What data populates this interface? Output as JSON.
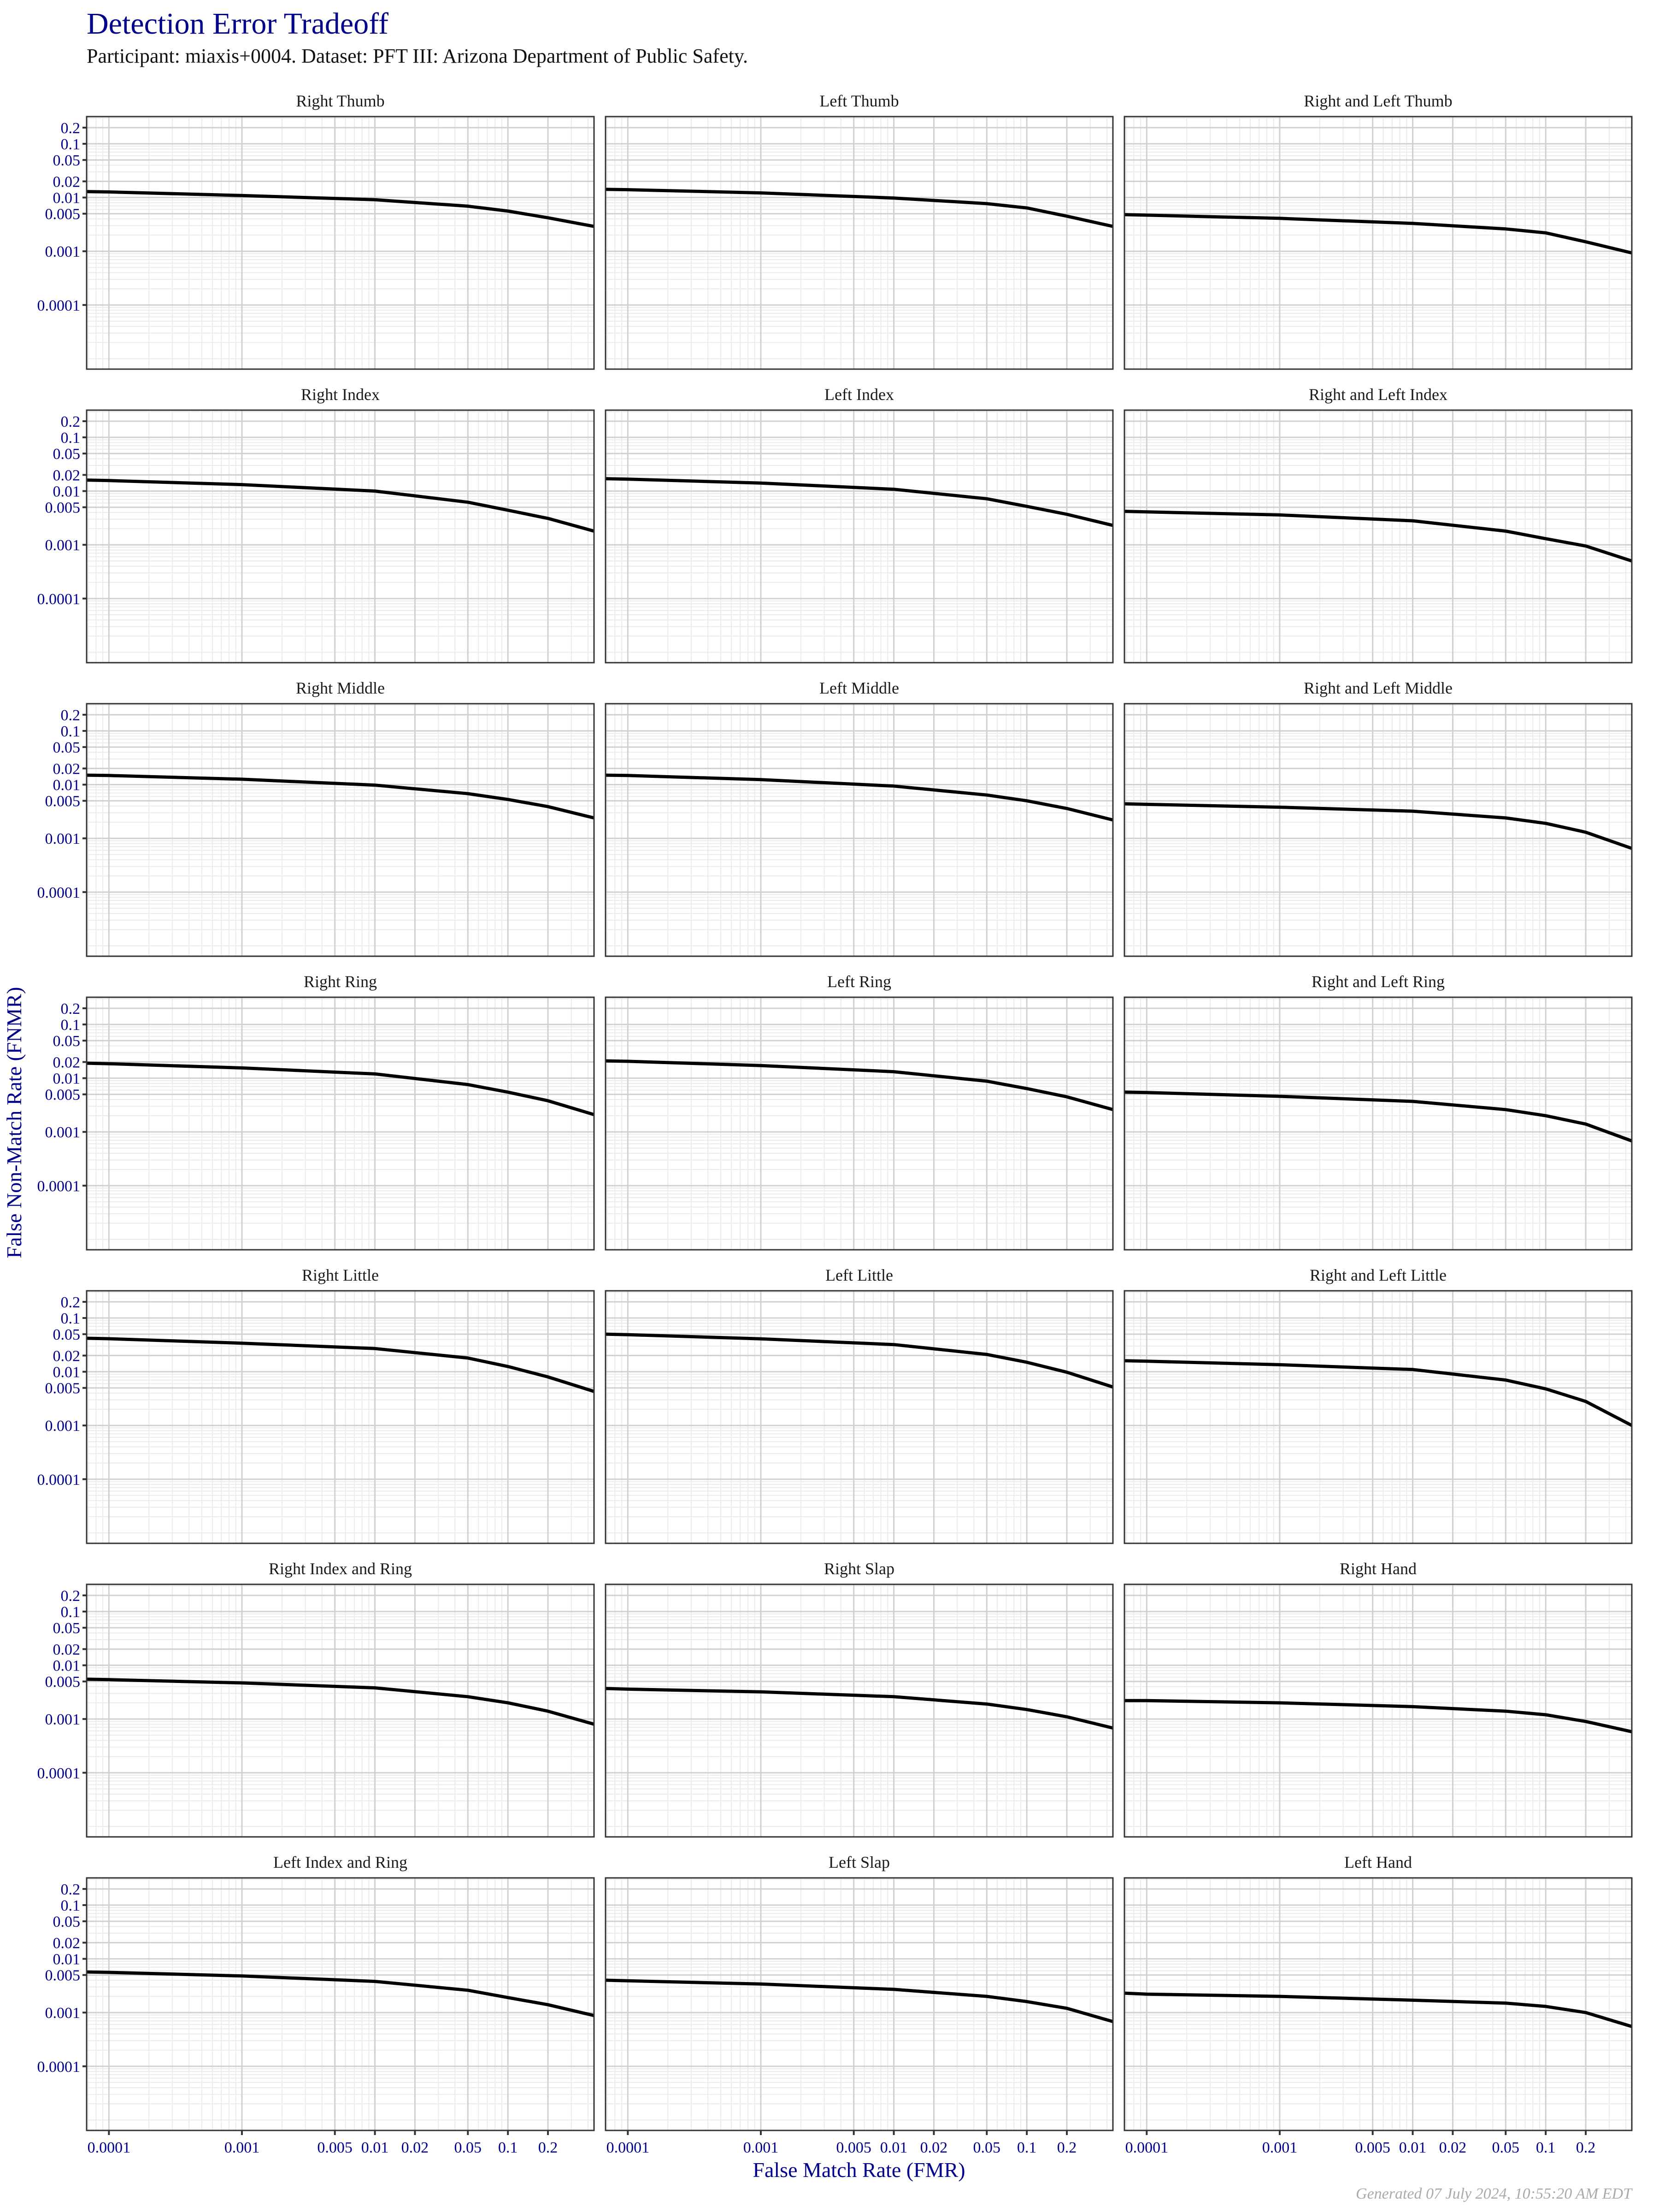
{
  "header": {
    "title": "Detection Error Tradeoff",
    "subtitle": "Participant: miaxis+0004. Dataset: PFT III: Arizona Department of Public Safety."
  },
  "footer": "Generated 07 July 2024, 10:55:20 AM EDT",
  "colors": {
    "title": "#00008b",
    "tick_labels": "#00008b",
    "curve": "#000000",
    "grid_major": "#d0d0d0",
    "grid_minor": "#ebebeb",
    "panel_border": "#333333",
    "footer": "#aaaaaa"
  },
  "chart_data": {
    "type": "line",
    "title": "Detection Error Tradeoff",
    "subtitle": "Participant: miaxis+0004. Dataset: PFT III: Arizona Department of Public Safety.",
    "xlabel": "False Match Rate (FMR)",
    "ylabel": "False Non-Match Rate (FNMR)",
    "xscale": "log",
    "yscale": "log",
    "xlim": [
      6.8e-05,
      0.444
    ],
    "ylim": [
      6.4e-06,
      0.321
    ],
    "x_ticks": [
      0.0001,
      0.001,
      0.005,
      0.01,
      0.02,
      0.05,
      0.1,
      0.2
    ],
    "x_tick_labels": [
      "0.0001",
      "0.001",
      "0.005",
      "0.01",
      "0.02",
      "0.05",
      "0.1",
      "0.2"
    ],
    "y_ticks": [
      0.2,
      0.1,
      0.05,
      0.02,
      0.01,
      0.005,
      0.001,
      0.0001
    ],
    "y_tick_labels": [
      "0.2",
      "0.1",
      "0.05",
      "0.02",
      "0.01",
      "0.005",
      "0.001",
      "0.0001"
    ],
    "grid": true,
    "layout": "facet grid, 7 rows x 3 columns",
    "sample_fmr": [
      6.8e-05,
      0.0001,
      0.001,
      0.01,
      0.05,
      0.1,
      0.2,
      0.444
    ],
    "panels": [
      {
        "name": "Right Thumb",
        "fnmr": [
          0.0129,
          0.0127,
          0.0109,
          0.0091,
          0.0069,
          0.0056,
          0.0042,
          0.0029
        ]
      },
      {
        "name": "Left Thumb",
        "fnmr": [
          0.0142,
          0.014,
          0.0122,
          0.0098,
          0.0077,
          0.0064,
          0.0045,
          0.0029
        ]
      },
      {
        "name": "Right and Left Thumb",
        "fnmr": [
          0.0048,
          0.0047,
          0.0041,
          0.0033,
          0.0026,
          0.0022,
          0.0015,
          0.00093
        ]
      },
      {
        "name": "Right Index",
        "fnmr": [
          0.016,
          0.0157,
          0.0132,
          0.01,
          0.0062,
          0.0044,
          0.0031,
          0.0018
        ]
      },
      {
        "name": "Left Index",
        "fnmr": [
          0.017,
          0.0167,
          0.0141,
          0.0108,
          0.0072,
          0.0052,
          0.0037,
          0.0023
        ]
      },
      {
        "name": "Right and Left Index",
        "fnmr": [
          0.0042,
          0.0041,
          0.0036,
          0.0028,
          0.0018,
          0.0013,
          0.00095,
          0.0005
        ]
      },
      {
        "name": "Right Middle",
        "fnmr": [
          0.015,
          0.0148,
          0.0126,
          0.0098,
          0.0068,
          0.0053,
          0.0039,
          0.0024
        ]
      },
      {
        "name": "Left Middle",
        "fnmr": [
          0.015,
          0.0148,
          0.0124,
          0.0094,
          0.0064,
          0.005,
          0.0036,
          0.0022
        ]
      },
      {
        "name": "Right and Left Middle",
        "fnmr": [
          0.0044,
          0.0043,
          0.0038,
          0.0032,
          0.0024,
          0.0019,
          0.0013,
          0.00065
        ]
      },
      {
        "name": "Right Ring",
        "fnmr": [
          0.019,
          0.0186,
          0.0155,
          0.012,
          0.0076,
          0.0055,
          0.0038,
          0.0021
        ]
      },
      {
        "name": "Left Ring",
        "fnmr": [
          0.021,
          0.0206,
          0.0172,
          0.0132,
          0.0088,
          0.0064,
          0.0045,
          0.0026
        ]
      },
      {
        "name": "Right and Left Ring",
        "fnmr": [
          0.0055,
          0.0054,
          0.0046,
          0.0037,
          0.0026,
          0.002,
          0.0014,
          0.00068
        ]
      },
      {
        "name": "Right Little",
        "fnmr": [
          0.042,
          0.0412,
          0.034,
          0.027,
          0.018,
          0.0125,
          0.008,
          0.0043
        ]
      },
      {
        "name": "Left Little",
        "fnmr": [
          0.05,
          0.049,
          0.041,
          0.032,
          0.021,
          0.015,
          0.0098,
          0.0052
        ]
      },
      {
        "name": "Right and Left Little",
        "fnmr": [
          0.016,
          0.0157,
          0.0135,
          0.011,
          0.007,
          0.0048,
          0.0028,
          0.001
        ]
      },
      {
        "name": "Right Index and Ring",
        "fnmr": [
          0.0055,
          0.0054,
          0.0047,
          0.0038,
          0.0026,
          0.002,
          0.0014,
          0.0008
        ]
      },
      {
        "name": "Right Slap",
        "fnmr": [
          0.0037,
          0.0036,
          0.0032,
          0.0026,
          0.0019,
          0.0015,
          0.0011,
          0.00068
        ]
      },
      {
        "name": "Right Hand",
        "fnmr": [
          0.0022,
          0.0022,
          0.002,
          0.0017,
          0.0014,
          0.0012,
          0.0009,
          0.00058
        ]
      },
      {
        "name": "Left Index and Ring",
        "fnmr": [
          0.0057,
          0.0056,
          0.0048,
          0.0038,
          0.0026,
          0.0019,
          0.0014,
          0.00088
        ]
      },
      {
        "name": "Left Slap",
        "fnmr": [
          0.004,
          0.0039,
          0.0034,
          0.0027,
          0.002,
          0.0016,
          0.0012,
          0.00068
        ]
      },
      {
        "name": "Left Hand",
        "fnmr": [
          0.0023,
          0.0022,
          0.002,
          0.0017,
          0.0015,
          0.0013,
          0.001,
          0.00055
        ]
      }
    ]
  }
}
